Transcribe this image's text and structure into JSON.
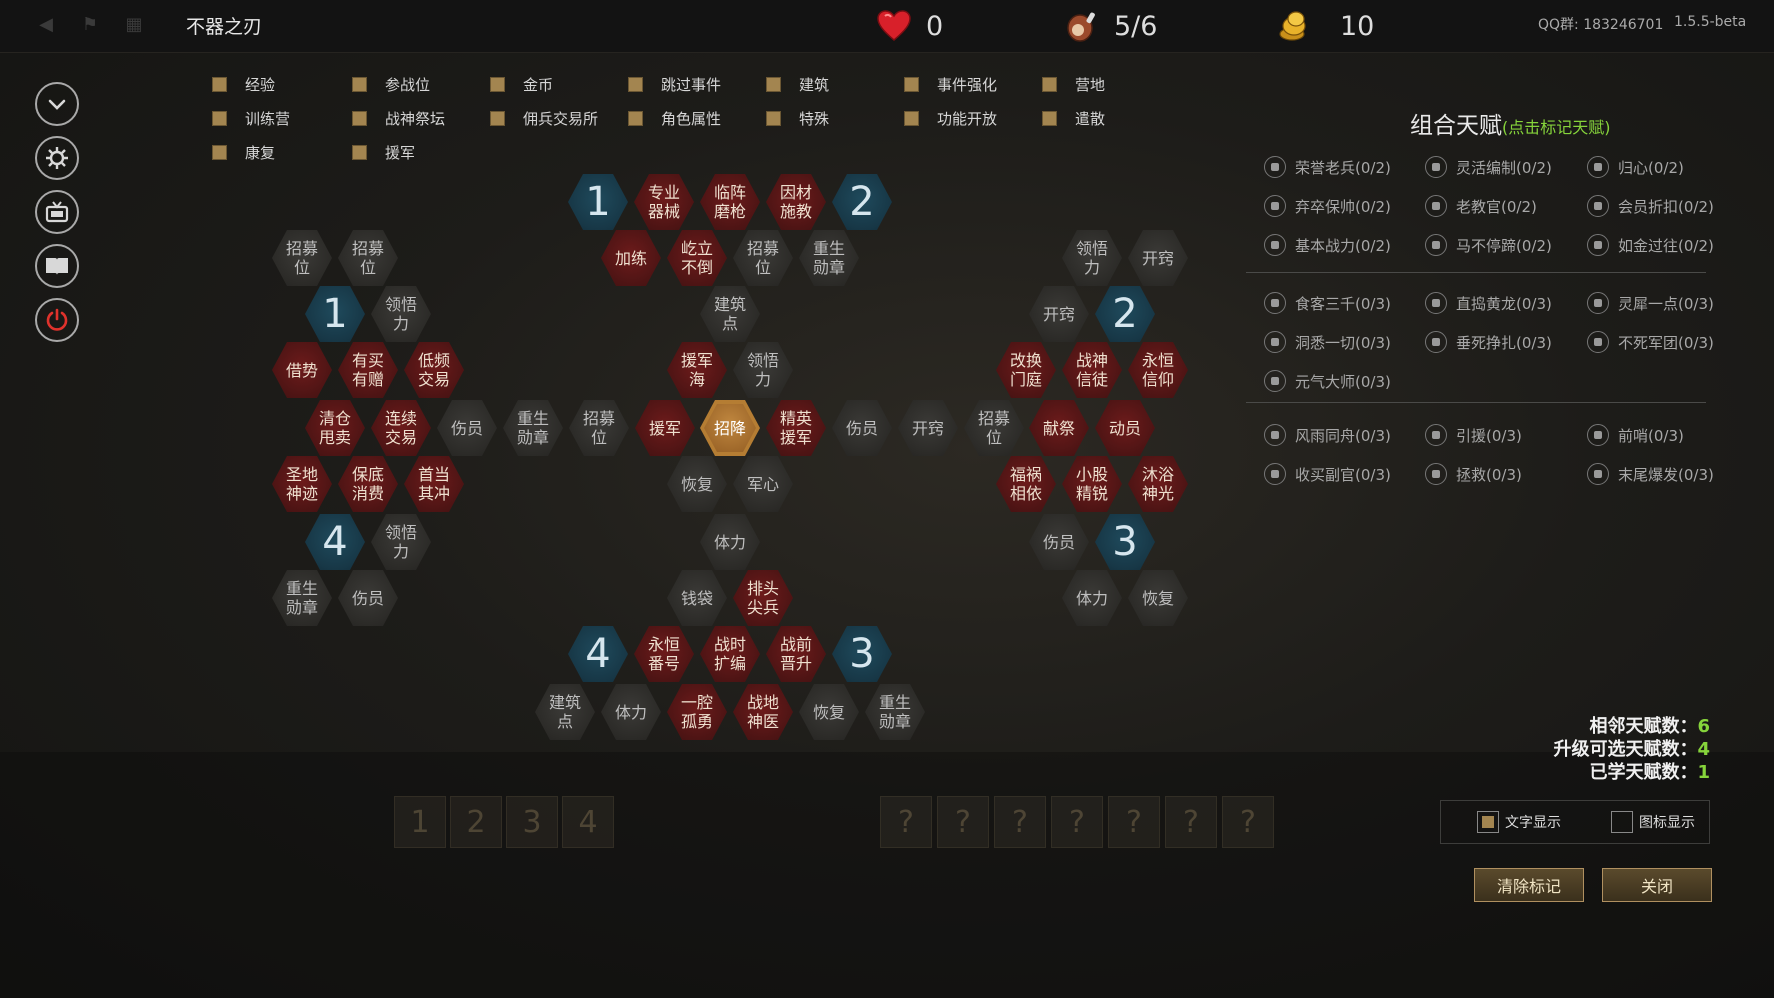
{
  "header": {
    "title": "不器之刃",
    "hearts": "0",
    "food": "5/6",
    "gold": "10",
    "qq_group": "QQ群: 183246701",
    "version": "1.5.5-beta"
  },
  "filters": [
    {
      "label": "经验"
    },
    {
      "label": "参战位"
    },
    {
      "label": "金币"
    },
    {
      "label": "跳过事件"
    },
    {
      "label": "建筑"
    },
    {
      "label": "事件强化"
    },
    {
      "label": "营地"
    },
    {
      "label": "训练营"
    },
    {
      "label": "战神祭坛"
    },
    {
      "label": "佣兵交易所"
    },
    {
      "label": "角色属性"
    },
    {
      "label": "特殊"
    },
    {
      "label": "功能开放"
    },
    {
      "label": "遣散"
    },
    {
      "label": "康复"
    },
    {
      "label": "援军"
    }
  ],
  "talent_tree": [
    {
      "label": "1",
      "type": "blue"
    },
    {
      "label": "专业\n器械",
      "type": "red"
    },
    {
      "label": "临阵\n磨枪",
      "type": "red"
    },
    {
      "label": "因材\n施教",
      "type": "red"
    },
    {
      "label": "2",
      "type": "blue"
    },
    {
      "label": "加练",
      "type": "red"
    },
    {
      "label": "屹立\n不倒",
      "type": "red"
    },
    {
      "label": "招募\n位",
      "type": "gray"
    },
    {
      "label": "重生\n勋章",
      "type": "gray"
    },
    {
      "label": "建筑\n点",
      "type": "gray"
    },
    {
      "label": "援军\n海",
      "type": "red"
    },
    {
      "label": "领悟\n力",
      "type": "gray"
    },
    {
      "label": "招募\n位",
      "type": "gray"
    },
    {
      "label": "招募\n位",
      "type": "gray"
    },
    {
      "label": "1",
      "type": "blue"
    },
    {
      "label": "领悟\n力",
      "type": "gray"
    },
    {
      "label": "借势",
      "type": "red"
    },
    {
      "label": "有买\n有赠",
      "type": "red"
    },
    {
      "label": "低频\n交易",
      "type": "red"
    },
    {
      "label": "清仓\n甩卖",
      "type": "red"
    },
    {
      "label": "连续\n交易",
      "type": "red"
    },
    {
      "label": "伤员",
      "type": "gray"
    },
    {
      "label": "重生\n勋章",
      "type": "gray"
    },
    {
      "label": "招募\n位",
      "type": "gray"
    },
    {
      "label": "援军",
      "type": "red"
    },
    {
      "label": "招降",
      "type": "gold"
    },
    {
      "label": "精英\n援军",
      "type": "red"
    },
    {
      "label": "伤员",
      "type": "gray"
    },
    {
      "label": "开窍",
      "type": "gray"
    },
    {
      "label": "招募\n位",
      "type": "gray"
    },
    {
      "label": "圣地\n神迹",
      "type": "red"
    },
    {
      "label": "保底\n消费",
      "type": "red"
    },
    {
      "label": "首当\n其冲",
      "type": "red"
    },
    {
      "label": "恢复",
      "type": "gray"
    },
    {
      "label": "军心",
      "type": "gray"
    },
    {
      "label": "4",
      "type": "blue"
    },
    {
      "label": "领悟\n力",
      "type": "gray"
    },
    {
      "label": "体力",
      "type": "gray"
    },
    {
      "label": "重生\n勋章",
      "type": "gray"
    },
    {
      "label": "伤员",
      "type": "gray"
    },
    {
      "label": "钱袋",
      "type": "gray"
    },
    {
      "label": "排头\n尖兵",
      "type": "red"
    },
    {
      "label": "领悟\n力",
      "type": "gray"
    },
    {
      "label": "开窍",
      "type": "gray"
    },
    {
      "label": "开窍",
      "type": "gray"
    },
    {
      "label": "2",
      "type": "blue"
    },
    {
      "label": "改换\n门庭",
      "type": "red"
    },
    {
      "label": "战神\n信徒",
      "type": "red"
    },
    {
      "label": "永恒\n信仰",
      "type": "red"
    },
    {
      "label": "献祭",
      "type": "red"
    },
    {
      "label": "动员",
      "type": "red"
    },
    {
      "label": "福祸\n相依",
      "type": "red"
    },
    {
      "label": "小股\n精锐",
      "type": "red"
    },
    {
      "label": "沐浴\n神光",
      "type": "red"
    },
    {
      "label": "伤员",
      "type": "gray"
    },
    {
      "label": "3",
      "type": "blue"
    },
    {
      "label": "体力",
      "type": "gray"
    },
    {
      "label": "恢复",
      "type": "gray"
    },
    {
      "label": "4",
      "type": "blue"
    },
    {
      "label": "永恒\n番号",
      "type": "red"
    },
    {
      "label": "战时\n扩编",
      "type": "red"
    },
    {
      "label": "战前\n晋升",
      "type": "red"
    },
    {
      "label": "3",
      "type": "blue"
    },
    {
      "label": "建筑\n点",
      "type": "gray"
    },
    {
      "label": "体力",
      "type": "gray"
    },
    {
      "label": "一腔\n孤勇",
      "type": "red"
    },
    {
      "label": "战地\n神医",
      "type": "red"
    },
    {
      "label": "恢复",
      "type": "gray"
    },
    {
      "label": "重生\n勋章",
      "type": "gray"
    }
  ],
  "combo": {
    "title": "组合天赋",
    "hint": "(点击标记天赋)",
    "groups": [
      [
        "荣誉老兵(0/2)",
        "灵活编制(0/2)",
        "归心(0/2)",
        "弃卒保帅(0/2)",
        "老教官(0/2)",
        "会员折扣(0/2)",
        "基本战力(0/2)",
        "马不停蹄(0/2)",
        "如金过往(0/2)"
      ],
      [
        "食客三千(0/3)",
        "直捣黄龙(0/3)",
        "灵犀一点(0/3)",
        "洞悉一切(0/3)",
        "垂死挣扎(0/3)",
        "不死军团(0/3)",
        "元气大师(0/3)"
      ],
      [
        "风雨同舟(0/3)",
        "引援(0/3)",
        "前哨(0/3)",
        "收买副官(0/3)",
        "拯救(0/3)",
        "末尾爆发(0/3)"
      ]
    ]
  },
  "stats": {
    "adjacent_label": "相邻天赋数：",
    "adjacent_value": "6",
    "upgrade_label": "升级可选天赋数：",
    "upgrade_value": "4",
    "learned_label": "已学天赋数：",
    "learned_value": "1"
  },
  "display": {
    "text_label": "文字显示",
    "icon_label": "图标显示",
    "text_checked": true,
    "icon_checked": false
  },
  "buttons": {
    "clear": "清除标记",
    "close": "关闭"
  }
}
